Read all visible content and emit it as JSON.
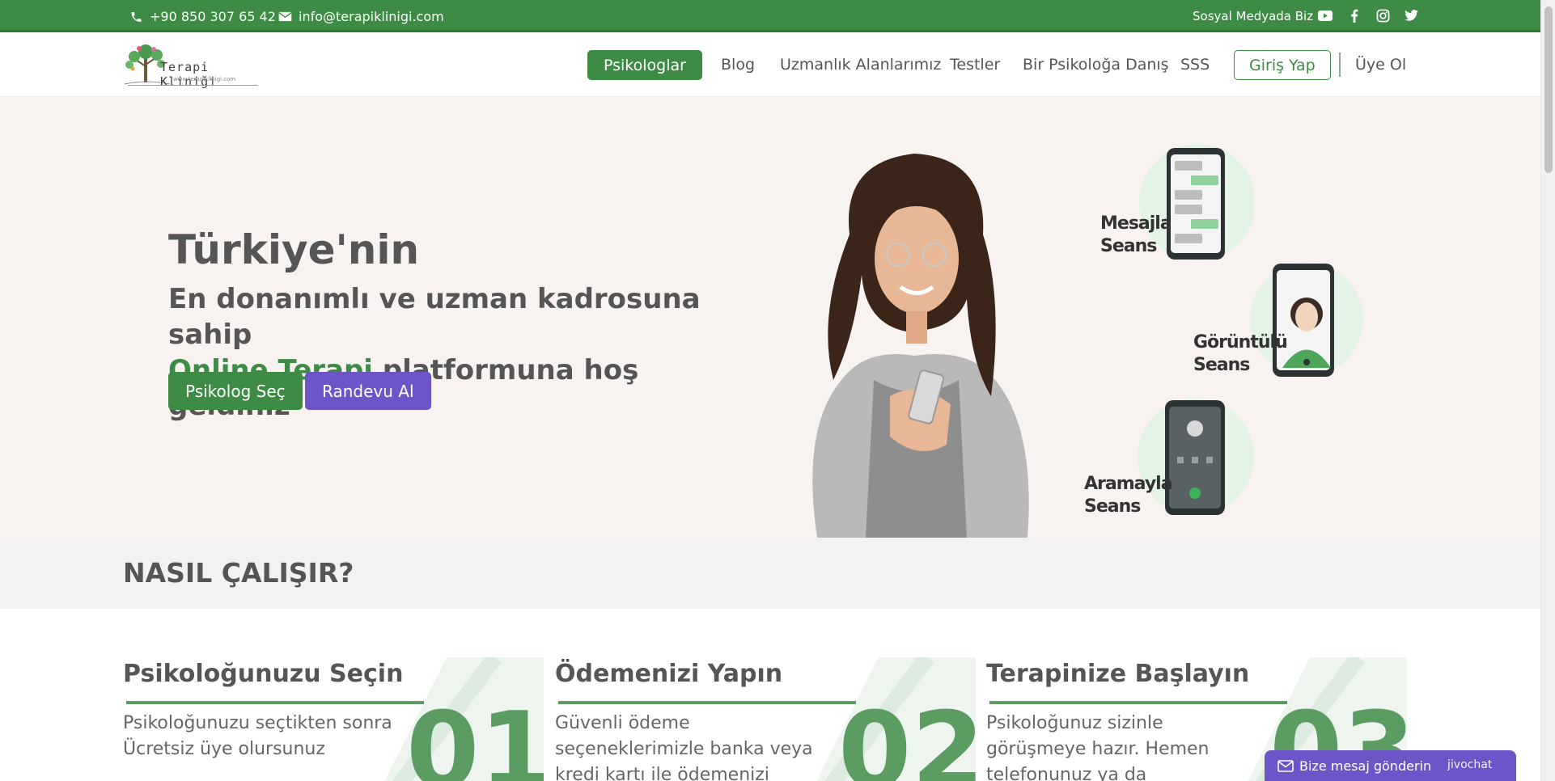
{
  "topbar": {
    "phone": "+90 850 307 65 42",
    "email": "info@terapiklinigi.com",
    "social_label": "Sosyal Medyada Biz",
    "social_icons": [
      "youtube-icon",
      "facebook-icon",
      "instagram-icon",
      "twitter-icon"
    ]
  },
  "nav": {
    "logo_text": "Terapi Kliniği",
    "logo_sub": "www.terapiklinigi.com",
    "primary": "Psikologlar",
    "links": [
      "Blog",
      "Uzmanlık Alanlarımız",
      "Testler",
      "Bir Psikoloğa Danış",
      "SSS"
    ],
    "login": "Giriş Yap",
    "register": "Üye Ol"
  },
  "hero": {
    "title": "Türkiye'nin",
    "line1": "En donanımlı ve uzman kadrosuna sahip",
    "line2_highlight": "Online Terapi",
    "line2_rest": " platformuna hoş geldiniz",
    "btn_select": "Psikolog Seç",
    "btn_appointment": "Randevu Al",
    "cards": {
      "message": [
        "Mesajla",
        "Seans"
      ],
      "video": [
        "Görüntülü",
        "Seans"
      ],
      "call": [
        "Aramayla",
        "Seans"
      ]
    }
  },
  "how": {
    "title": "NASIL ÇALIŞIR?"
  },
  "steps": [
    {
      "title": "Psikoloğunuzu Seçin",
      "text": "Psikoloğunuzu seçtikten sonra Ücretsiz üye olursunuz",
      "num": "01"
    },
    {
      "title": "Ödemenizi Yapın",
      "text": "Güvenli ödeme seçeneklerimizle banka veya kredi kartı ile ödemenizi kolaylıkla",
      "num": "02"
    },
    {
      "title": "Terapinize Başlayın",
      "text": "Psikoloğunuz sizinle görüşmeye hazır. Hemen telefonunuz ya da bilgisayarınızdan",
      "num": "03"
    }
  ],
  "chat": {
    "label": "Bize mesaj gönderin",
    "brand": "jivochat"
  },
  "colors": {
    "green": "#3d8b45",
    "purple": "#6d55c9",
    "hero_bg": "#f8f3f0"
  }
}
